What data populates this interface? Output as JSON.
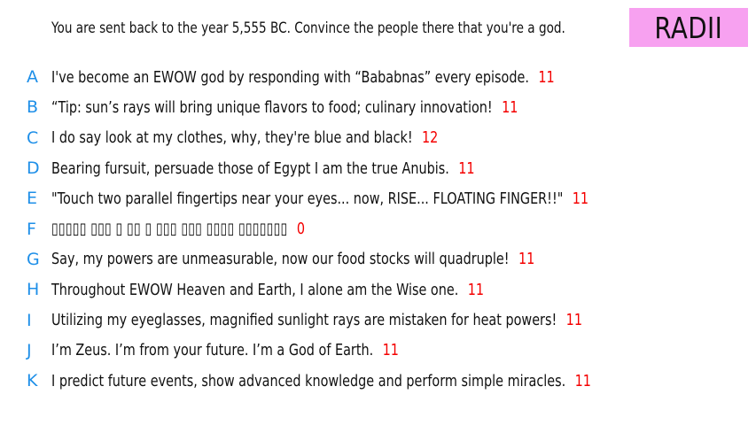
{
  "prompt": "You are sent back to the year 5,555 BC. Convince the people there that you're a god.",
  "badge": {
    "label": "RADII",
    "color": "#f7a1f0"
  },
  "colors": {
    "letter": "#1e8fe8",
    "score": "#f40000",
    "text": "#111111"
  },
  "entries": [
    {
      "letter": "A",
      "text": "I've become an EWOW god by responding with “Bababnas” every episode.",
      "score": "11"
    },
    {
      "letter": "B",
      "text": "“Tip: sun’s rays will bring unique flavors to food; culinary innovation!",
      "score": "11"
    },
    {
      "letter": "C",
      "text": "I do say look at my clothes, why, they're blue and black!",
      "score": "12"
    },
    {
      "letter": "D",
      "text": "Bearing fursuit, persuade those of Egypt I am the true Anubis.",
      "score": "11"
    },
    {
      "letter": "E",
      "text": "\"Touch two parallel fingertips near your eyes... now, RISE... FLOATING FINGER!!\"",
      "score": "11"
    },
    {
      "letter": "F",
      "text": "▯▯▯▯▯ ▯▯▯ ▯ ▯▯ ▯ ▯▯▯ ▯▯▯ ▯▯▯▯ ▯▯▯▯▯▯▯",
      "score": "0"
    },
    {
      "letter": "G",
      "text": "Say, my powers are unmeasurable, now our food stocks will quadruple!",
      "score": "11"
    },
    {
      "letter": "H",
      "text": "Throughout EWOW Heaven and Earth, I alone am the Wise one.",
      "score": "11"
    },
    {
      "letter": "I",
      "text": "Utilizing my eyeglasses, magnified sunlight rays are mistaken for heat powers!",
      "score": "11"
    },
    {
      "letter": "J",
      "text": "I’m Zeus. I’m from your future. I’m a God of Earth.",
      "score": "11"
    },
    {
      "letter": "K",
      "text": "I predict future events, show advanced knowledge and perform simple miracles.",
      "score": "11"
    }
  ]
}
